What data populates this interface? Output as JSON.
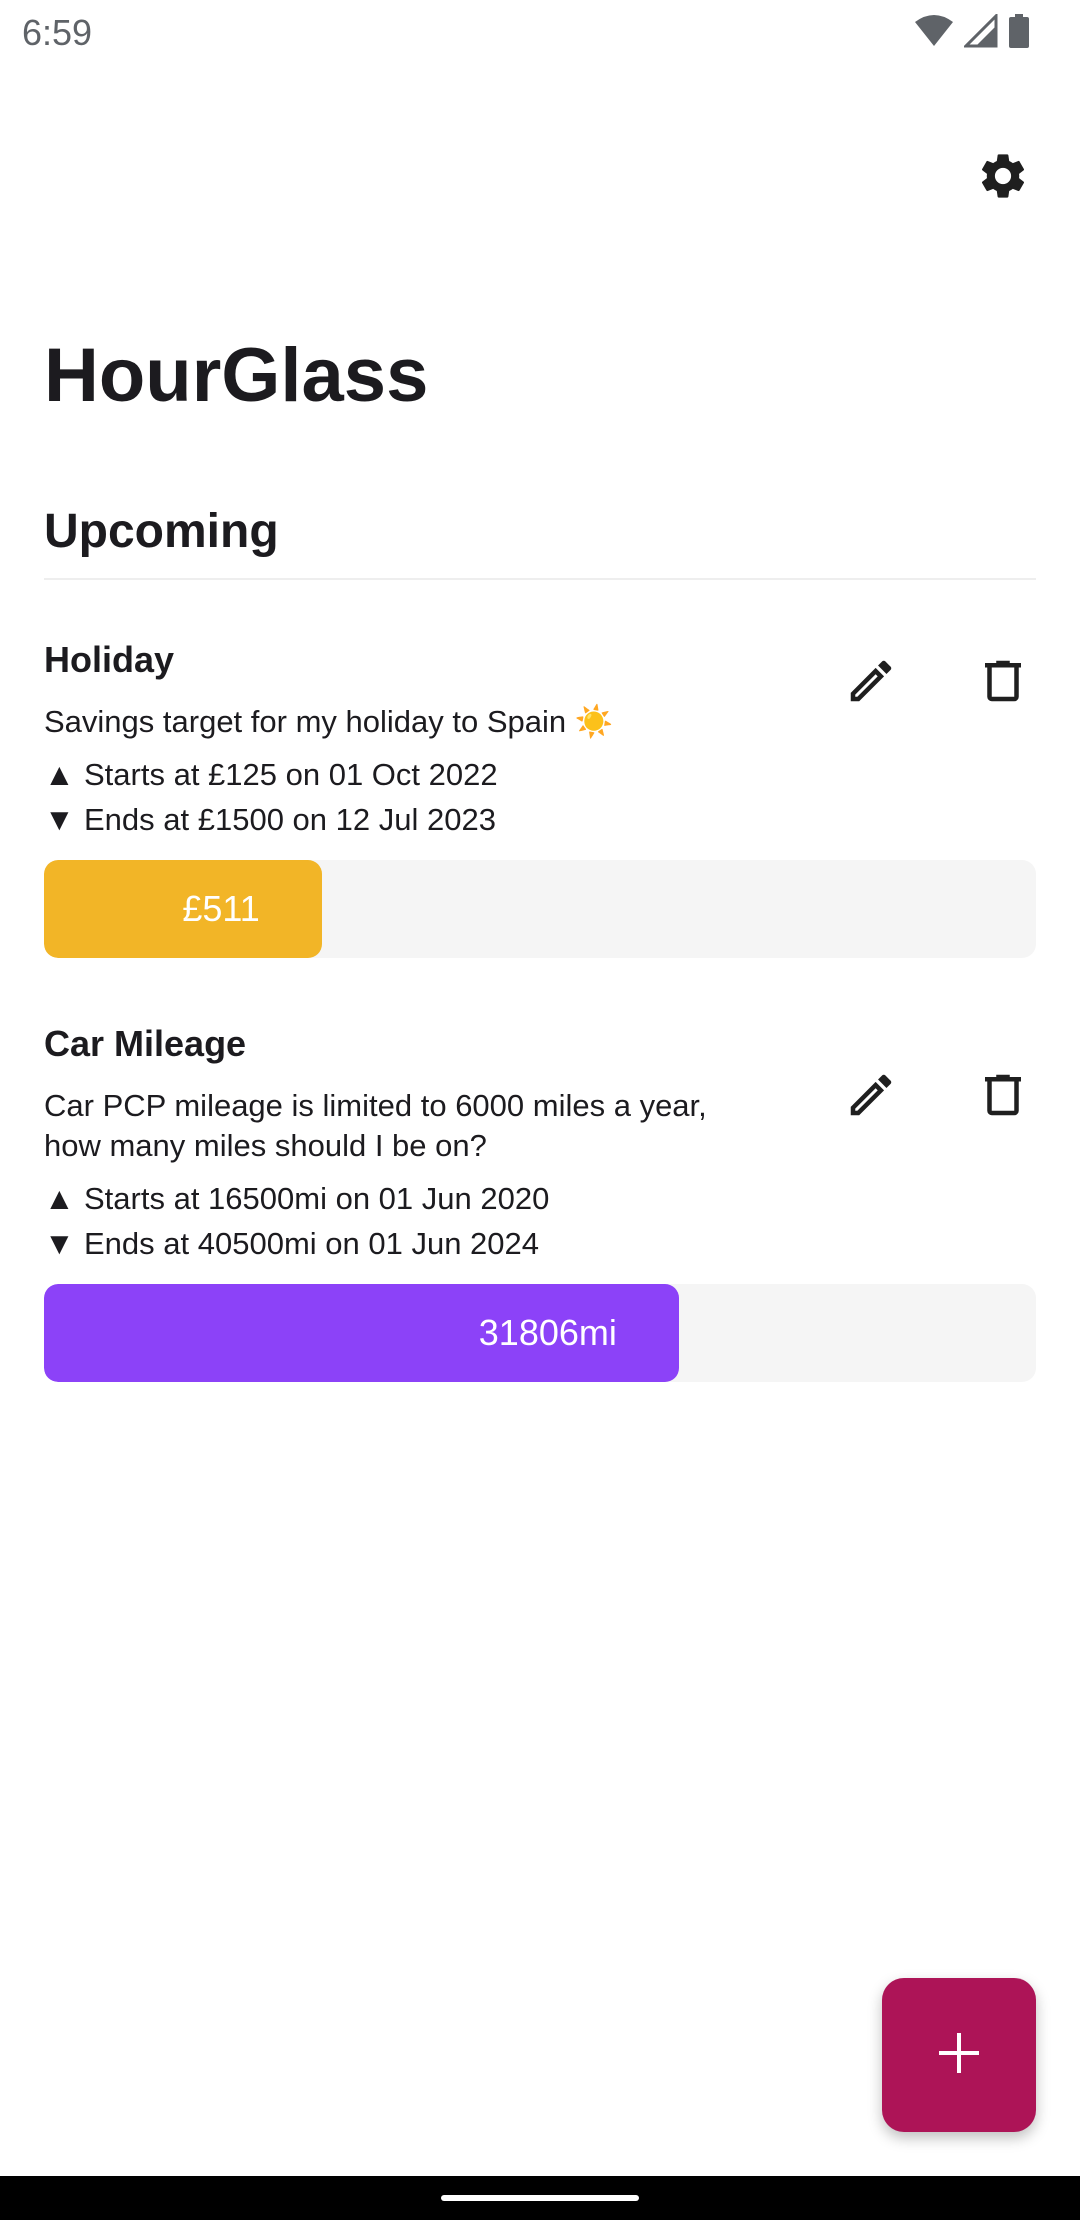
{
  "status_bar": {
    "time": "6:59",
    "icons": [
      "wifi-icon",
      "signal-icon",
      "battery-icon"
    ]
  },
  "header": {
    "settings_icon": "gear-icon"
  },
  "app_title": "HourGlass",
  "section_title": "Upcoming",
  "colors": {
    "holiday_bar": "#f2b527",
    "mileage_bar": "#8c42f8",
    "track": "#f5f5f5",
    "fab": "#ad1457"
  },
  "cards": [
    {
      "title": "Holiday",
      "description": "Savings target for my holiday to Spain ☀️",
      "start_line": "Starts at £125 on 01 Oct 2022",
      "end_line": "Ends at £1500 on 12 Jul 2023",
      "progress_label": "£511",
      "progress_fraction": 0.28,
      "edit_icon": "pencil-icon",
      "delete_icon": "trash-icon"
    },
    {
      "title": "Car Mileage",
      "description": "Car PCP mileage is limited to 6000 miles a year, how many miles should I be on?",
      "start_line": "Starts at 16500mi on 01 Jun 2020",
      "end_line": "Ends at 40500mi on 01 Jun 2024",
      "progress_label": "31806mi",
      "progress_fraction": 0.64,
      "edit_icon": "pencil-icon",
      "delete_icon": "trash-icon"
    }
  ],
  "fab": {
    "icon": "plus-icon"
  },
  "symbols": {
    "up": "▲",
    "down": "▼"
  }
}
